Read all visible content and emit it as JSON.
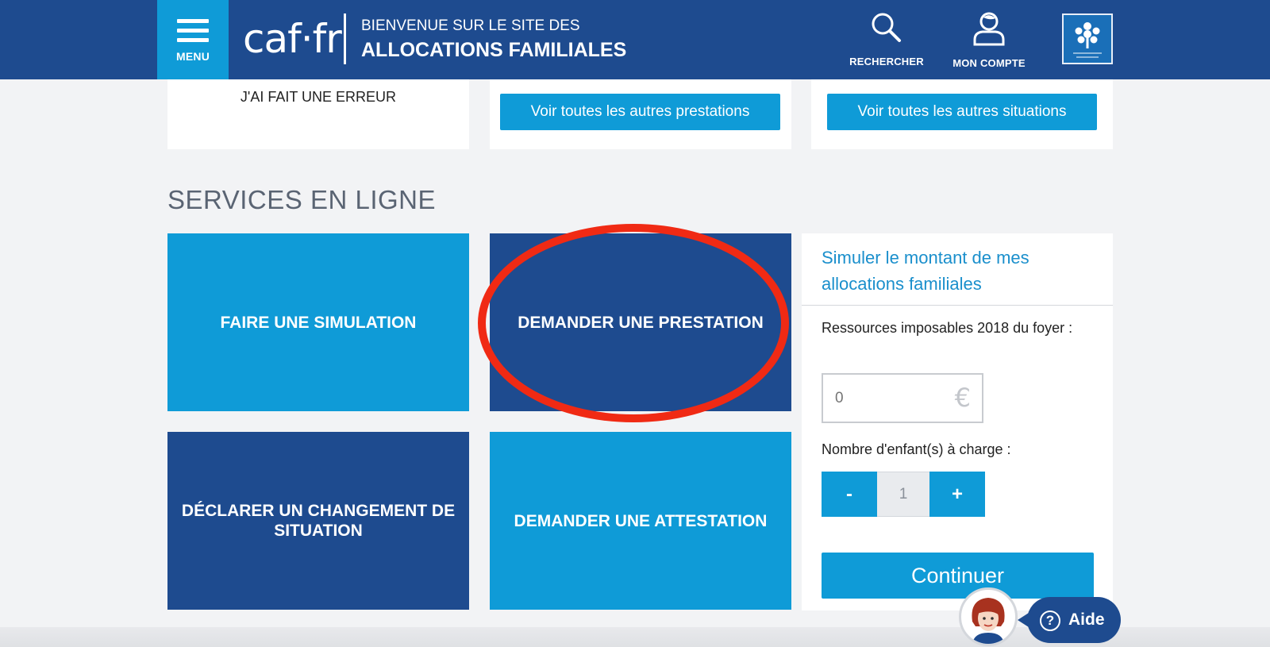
{
  "header": {
    "menu_label": "MENU",
    "logo_text": "caf·fr",
    "welcome_line1": "BIENVENUE SUR LE SITE DES",
    "welcome_line2": "ALLOCATIONS FAMILIALES",
    "search_label": "RECHERCHER",
    "account_label": "MON COMPTE",
    "brand_logo_text": "ALLOCATIONS FAMILIALES"
  },
  "top_cards": {
    "error_text": "J'AI FAIT UNE ERREUR",
    "benefits_button": "Voir toutes les autres prestations",
    "situations_button": "Voir toutes les autres situations"
  },
  "services": {
    "title": "SERVICES EN LIGNE",
    "tiles": [
      "FAIRE UNE SIMULATION",
      "DEMANDER UNE PRESTATION",
      "DÉCLARER UN CHANGEMENT DE SITUATION",
      "DEMANDER UNE ATTESTATION"
    ]
  },
  "simulator": {
    "title": "Simuler le montant de mes allocations familiales",
    "income_label": "Ressources imposables 2018 du foyer :",
    "income_placeholder": "0",
    "currency_symbol": "€",
    "children_label": "Nombre d'enfant(s) à charge :",
    "minus_label": "-",
    "children_value": "1",
    "plus_label": "+",
    "continue_label": "Continuer"
  },
  "help": {
    "icon_glyph": "?",
    "label": "Aide"
  },
  "colors": {
    "header_blue": "#1e4b8f",
    "light_blue": "#0f9bd7",
    "highlight_red": "#f02a14",
    "background": "#f2f3f5"
  }
}
